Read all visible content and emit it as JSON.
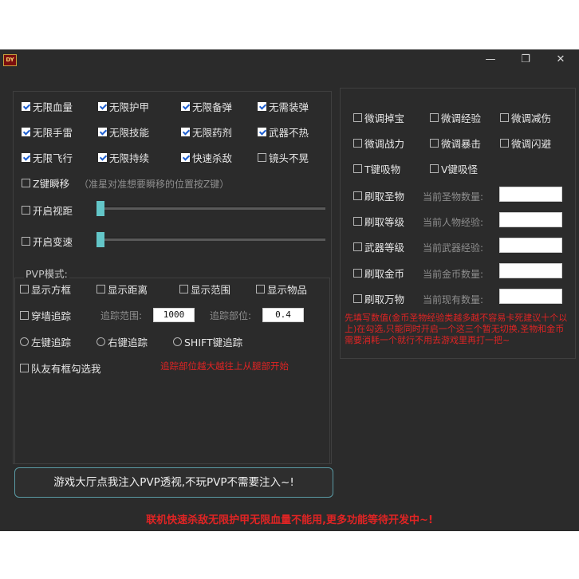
{
  "titlebar": {
    "logo_text": "DY",
    "minimize": "—",
    "restore": "❐",
    "close": "✕"
  },
  "left_checks": [
    {
      "label": "无限血量",
      "checked": true
    },
    {
      "label": "无限护甲",
      "checked": true
    },
    {
      "label": "无限备弹",
      "checked": true
    },
    {
      "label": "无需装弹",
      "checked": true
    },
    {
      "label": "无限手雷",
      "checked": true
    },
    {
      "label": "无限技能",
      "checked": true
    },
    {
      "label": "无限药剂",
      "checked": true
    },
    {
      "label": "武器不热",
      "checked": true
    },
    {
      "label": "无限飞行",
      "checked": true
    },
    {
      "label": "无限持续",
      "checked": true
    },
    {
      "label": "快速杀敌",
      "checked": true
    },
    {
      "label": "镜头不晃",
      "checked": false
    }
  ],
  "z_teleport": {
    "label": "Z键瞬移",
    "hint": "（准星对准想要瞬移的位置按Z键）",
    "checked": false
  },
  "view_distance": {
    "label": "开启视距",
    "checked": false,
    "level": 0
  },
  "speed_change": {
    "label": "开启变速",
    "checked": false,
    "level": 0
  },
  "pvp": {
    "title": "PVP模式:",
    "checks": [
      {
        "label": "显示方框",
        "checked": false
      },
      {
        "label": "显示距离",
        "checked": false
      },
      {
        "label": "显示范围",
        "checked": false
      },
      {
        "label": "显示物品",
        "checked": false
      }
    ],
    "wall_track": {
      "label": "穿墙追踪",
      "checked": false
    },
    "track_range_label": "追踪范围:",
    "track_range_value": "1000",
    "track_part_label": "追踪部位:",
    "track_part_value": "0.4",
    "radios": [
      {
        "label": "左键追踪"
      },
      {
        "label": "右键追踪"
      },
      {
        "label": "SHIFT键追踪"
      }
    ],
    "teammate": {
      "label": "队友有框勾选我",
      "checked": false
    },
    "note": "追踪部位越大越往上从腿部开始"
  },
  "right_checks": [
    {
      "label": "微调掉宝",
      "checked": false
    },
    {
      "label": "微调经验",
      "checked": false
    },
    {
      "label": "微调减伤",
      "checked": false
    },
    {
      "label": "微调战力",
      "checked": false
    },
    {
      "label": "微调暴击",
      "checked": false
    },
    {
      "label": "微调闪避",
      "checked": false
    },
    {
      "label": "T键吸物",
      "checked": false
    },
    {
      "label": "V键吸怪",
      "checked": false
    }
  ],
  "farm_rows": [
    {
      "label": "刷取圣物",
      "current": "当前圣物数量:",
      "value": ""
    },
    {
      "label": "刷取等级",
      "current": "当前人物经验:",
      "value": ""
    },
    {
      "label": "武器等级",
      "current": "当前武器经验:",
      "value": ""
    },
    {
      "label": "刷取金币",
      "current": "当前金币数量:",
      "value": ""
    },
    {
      "label": "刷取万物",
      "current": "当前现有数量:",
      "value": ""
    }
  ],
  "right_note": "先填写数值(金币圣物经验类越多越不容易卡死建议十个以上)在勾选,只能同时开启一个这三个暂无切换,圣物和金币需要消耗一个就行不用去游戏里再打一把~",
  "inject_button": "游戏大厅点我注入PVP透视,不玩PVP不需要注入~!",
  "footer": "联机快速杀敌无限护甲无限血量不能用,更多功能等待开发中~!",
  "colors": {
    "background": "#2b2b2b",
    "accent": "#63c6c8",
    "warning": "#e02424"
  }
}
